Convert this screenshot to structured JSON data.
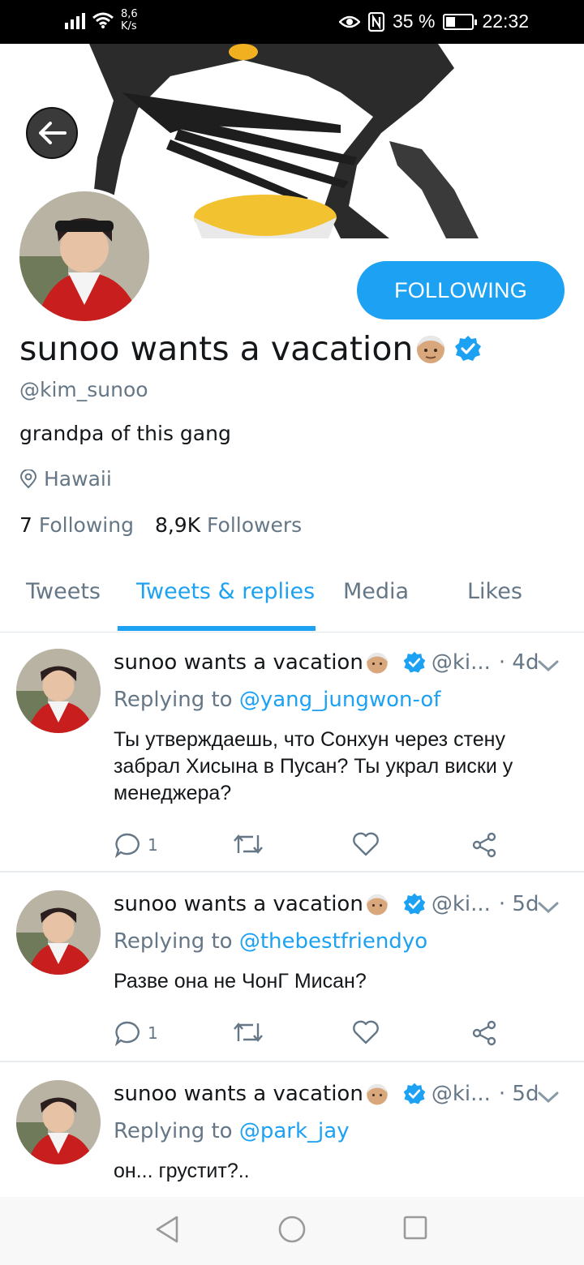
{
  "status_bar": {
    "net_speed_value": "8,6",
    "net_speed_unit": "K/s",
    "battery_percent": "35 %",
    "time": "22:32",
    "icons": [
      "signal-icon",
      "wifi-icon",
      "eye-icon",
      "nfc-icon",
      "battery-icon"
    ]
  },
  "profile": {
    "name": "sunoo wants a vacation",
    "emoji": "older-man-emoji",
    "verified": true,
    "handle": "@kim_sunoo",
    "bio": "grandpa of this gang",
    "location": "Hawaii",
    "following_count": "7",
    "following_label": "Following",
    "followers_count": "8,9K",
    "followers_label": "Followers",
    "follow_button_label": "FOLLOWING"
  },
  "tabs": [
    {
      "label": "Tweets",
      "active": false
    },
    {
      "label": "Tweets & replies",
      "active": true
    },
    {
      "label": "Media",
      "active": false
    },
    {
      "label": "Likes",
      "active": false
    }
  ],
  "tweets": [
    {
      "name": "sunoo wants a vacation",
      "handle": "@ki...",
      "time": "· 4d",
      "replying_label": "Replying to",
      "mention": "@yang_jungwon",
      "mention_suffix": "-of",
      "text": "Ты утверждаешь, что Сонхун через стену забрал Хисына в Пусан? Ты украл виски у менеджера?",
      "reply_count": "1"
    },
    {
      "name": "sunoo wants a vacation",
      "handle": "@ki...",
      "time": "· 5d",
      "replying_label": "Replying to",
      "mention": "@thebestfriendyo",
      "mention_suffix": "",
      "text": "Разве она не ЧонГ Мисан?",
      "reply_count": "1"
    },
    {
      "name": "sunoo wants a vacation",
      "handle": "@ki...",
      "time": "· 5d",
      "replying_label": "Replying to",
      "mention": "@park_jay",
      "mention_suffix": "",
      "text": "он... грустит?..",
      "reply_count": ""
    }
  ],
  "colors": {
    "accent": "#1da1f2",
    "secondary_text": "#657786",
    "primary_text": "#14171a"
  }
}
